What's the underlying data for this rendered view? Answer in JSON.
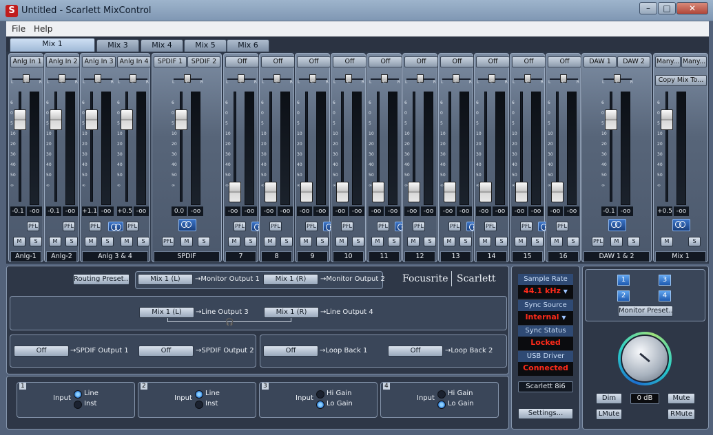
{
  "window": {
    "title": "Untitled - Scarlett MixControl",
    "app_icon": "S"
  },
  "menu": [
    "File",
    "Help"
  ],
  "tabs": [
    "Mix 1",
    "Mix 3",
    "Mix 4",
    "Mix 5",
    "Mix 6"
  ],
  "faders": {
    "zero": "0.0",
    "off": "-oo"
  },
  "channels": [
    {
      "src": "Anlg In 1",
      "label": "Anlg-1",
      "left": -0.1,
      "right": "-oo"
    },
    {
      "src": "Anlg In 2",
      "label": "Anlg-2",
      "left": -0.1,
      "right": "-oo"
    },
    {
      "src": "Anlg In 3",
      "label": "Anlg 3 & 4",
      "left": "+1.1",
      "right": "-oo"
    },
    {
      "src": "Anlg In 4",
      "label": "4",
      "left": "+0.5",
      "right": "-oo"
    },
    {
      "src": "SPDIF 1",
      "src2": "SPDIF 2",
      "label": "SPDIF",
      "left": "0.0",
      "right": "-oo",
      "mid": "-oo"
    },
    {
      "src": "Off",
      "label": "7"
    },
    {
      "src": "Off",
      "label": "8"
    },
    {
      "src": "Off",
      "label": "9"
    },
    {
      "src": "Off",
      "label": "10"
    },
    {
      "src": "Off",
      "label": "11"
    },
    {
      "src": "Off",
      "label": "12"
    },
    {
      "src": "Off",
      "label": "13"
    },
    {
      "src": "Off",
      "label": "14"
    },
    {
      "src": "Off",
      "label": "15"
    },
    {
      "src": "Off",
      "label": "16"
    },
    {
      "src": "DAW 1",
      "src2": "DAW 2",
      "label": "DAW 1 & 2",
      "left": "-0.1",
      "right": "-oo",
      "mid": "-oo"
    },
    {
      "src": "Many...",
      "src2": "Many...",
      "label": "Mix 1",
      "left": "+0.5",
      "right": "-oo",
      "mid": "-oo",
      "copy": "Copy Mix To..."
    }
  ],
  "strip_buttons": {
    "pfl": "PFL",
    "mute": "M",
    "solo": "S"
  },
  "routing": {
    "preset": "Routing Preset...",
    "logo1": "Focusrite",
    "logo2": "Scarlett",
    "rows": [
      [
        {
          "src": "Mix 1 (L)",
          "dst": "Monitor Output 1"
        },
        {
          "src": "Mix 1 (R)",
          "dst": "Monitor Output 2"
        }
      ],
      [
        {
          "src": "Mix 1 (L)",
          "dst": "Line Output 3"
        },
        {
          "src": "Mix 1 (R)",
          "dst": "Line Output 4"
        }
      ],
      [
        {
          "src": "Off",
          "dst": "SPDIF Output 1"
        },
        {
          "src": "Off",
          "dst": "SPDIF Output 2"
        },
        {
          "src": "Off",
          "dst": "Loop Back 1"
        },
        {
          "src": "Off",
          "dst": "Loop Back 2"
        }
      ]
    ]
  },
  "inputs": [
    {
      "n": "1",
      "label": "Input",
      "a": "Line",
      "b": "Inst",
      "sel": "a"
    },
    {
      "n": "2",
      "label": "Input",
      "a": "Line",
      "b": "Inst",
      "sel": "a"
    },
    {
      "n": "3",
      "label": "Input",
      "a": "Hi Gain",
      "b": "Lo Gain",
      "sel": "b"
    },
    {
      "n": "4",
      "label": "Input",
      "a": "Hi Gain",
      "b": "Lo Gain",
      "sel": "b"
    }
  ],
  "status": {
    "sample_rate_title": "Sample Rate",
    "sample_rate": "44.1 kHz",
    "sync_source_title": "Sync Source",
    "sync_source": "Internal",
    "sync_status_title": "Sync Status",
    "sync_status": "Locked",
    "usb_title": "USB  Driver",
    "usb": "Connected",
    "device": "Scarlett 8i6",
    "settings": "Settings..."
  },
  "monitor": {
    "nums": [
      "1",
      "3",
      "2",
      "4"
    ],
    "preset": "Monitor Preset...",
    "dim": "Dim",
    "level": "0 dB",
    "mute": "Mute",
    "lmute": "LMute",
    "rmute": "RMute"
  }
}
